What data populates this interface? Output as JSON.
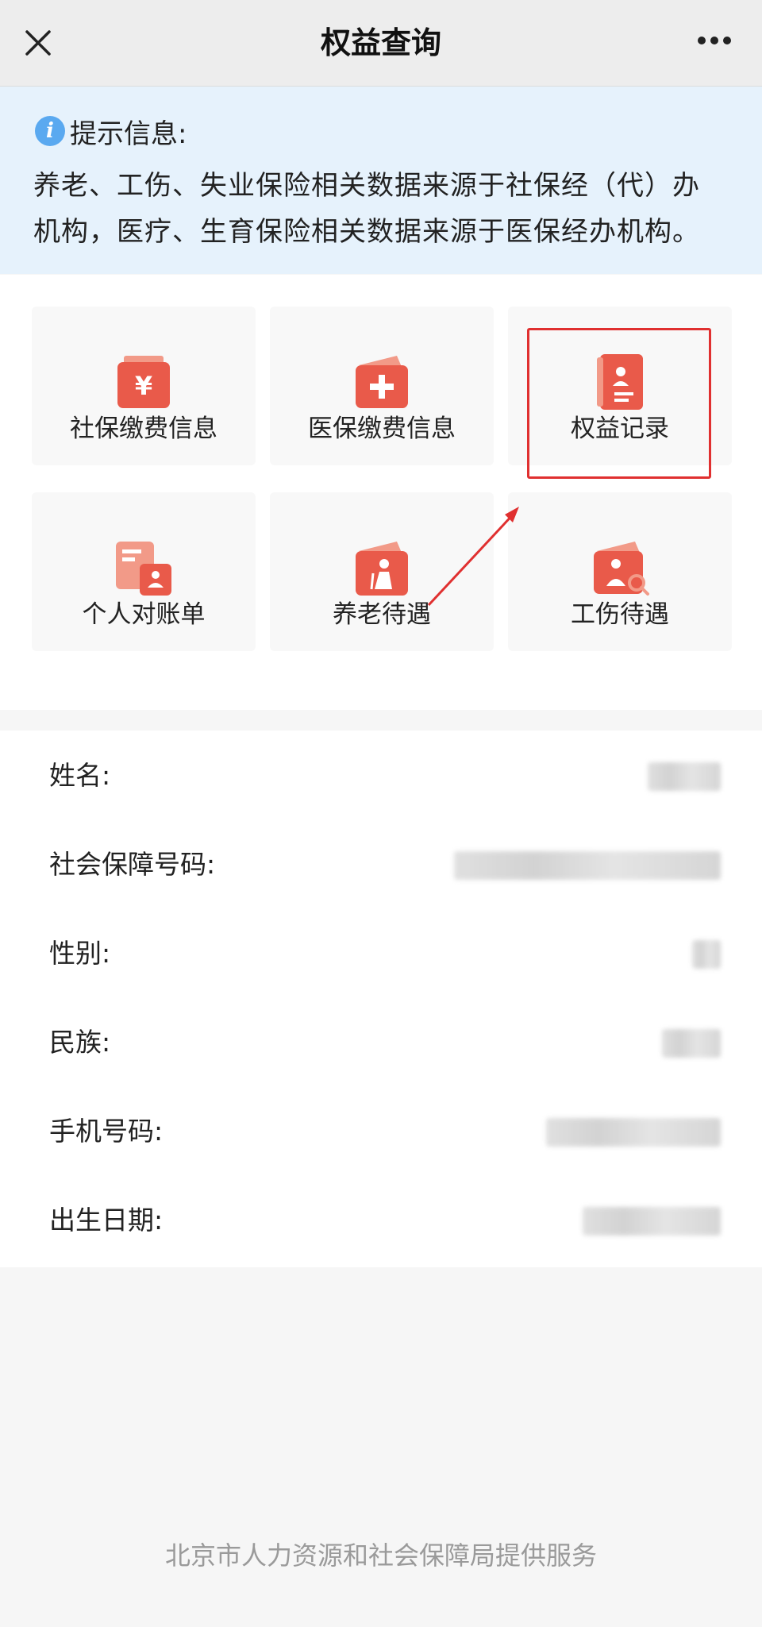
{
  "topbar": {
    "title": "权益查询",
    "close_icon": "close-icon",
    "more_icon": "more-icon"
  },
  "notice": {
    "icon": "info-icon",
    "label": "提示信息:",
    "line1": "养老、工伤、失业保险相关数据来源于社保经（代）办",
    "line2": "机构，医疗、生育保险相关数据来源于医保经办机构。"
  },
  "colors": {
    "accent": "#e95a4a",
    "highlight": "#e03030",
    "notice_bg": "#e6f2fc"
  },
  "tiles": [
    {
      "label": "社保缴费信息",
      "icon": "yuan-wallet-icon"
    },
    {
      "label": "医保缴费信息",
      "icon": "medical-wallet-icon"
    },
    {
      "label": "权益记录",
      "icon": "record-document-icon"
    },
    {
      "label": "个人对账单",
      "icon": "statement-icon"
    },
    {
      "label": "养老待遇",
      "icon": "pension-icon"
    },
    {
      "label": "工伤待遇",
      "icon": "injury-search-icon"
    }
  ],
  "info": [
    {
      "key": "姓名:"
    },
    {
      "key": "社会保障号码:"
    },
    {
      "key": "性别:"
    },
    {
      "key": "民族:"
    },
    {
      "key": "手机号码:"
    },
    {
      "key": "出生日期:"
    }
  ],
  "footer": "北京市人力资源和社会保障局提供服务"
}
